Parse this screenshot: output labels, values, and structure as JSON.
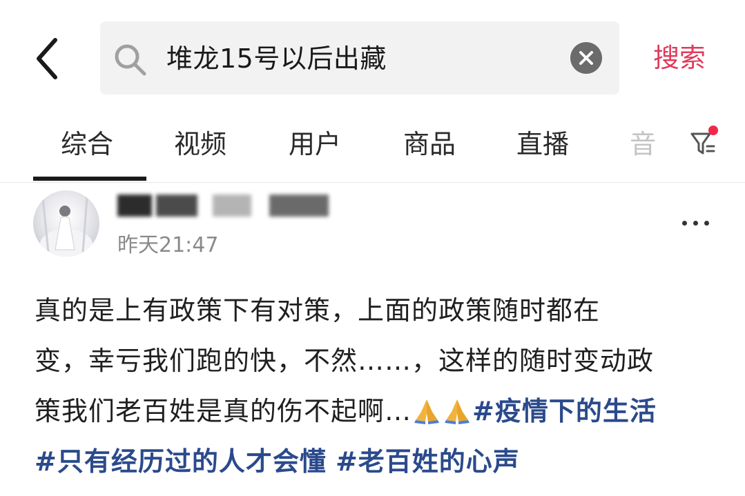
{
  "header": {
    "search_query": "堆龙15号以后出藏",
    "search_button": "搜索"
  },
  "tabs": [
    {
      "label": "综合",
      "active": true
    },
    {
      "label": "视频"
    },
    {
      "label": "用户"
    },
    {
      "label": "商品"
    },
    {
      "label": "直播"
    },
    {
      "label": "音"
    }
  ],
  "colors": {
    "accent": "#e03a5b",
    "hashtag": "#2b4a8c",
    "muted": "#8a8a8a"
  },
  "post": {
    "time": "昨天21:47",
    "lines": [
      "真的是上有政策下有对策，上面的政策随时都在",
      "变，幸亏我们跑的快，不然……，这样的随时变动政",
      "策我们老百姓是真的伤不起啊…"
    ],
    "emoji": [
      "folded-hands",
      "folded-hands"
    ],
    "hashtags": [
      "#疫情下的生活",
      "#只有经历过的人才会懂",
      "#老百姓的心声"
    ]
  }
}
